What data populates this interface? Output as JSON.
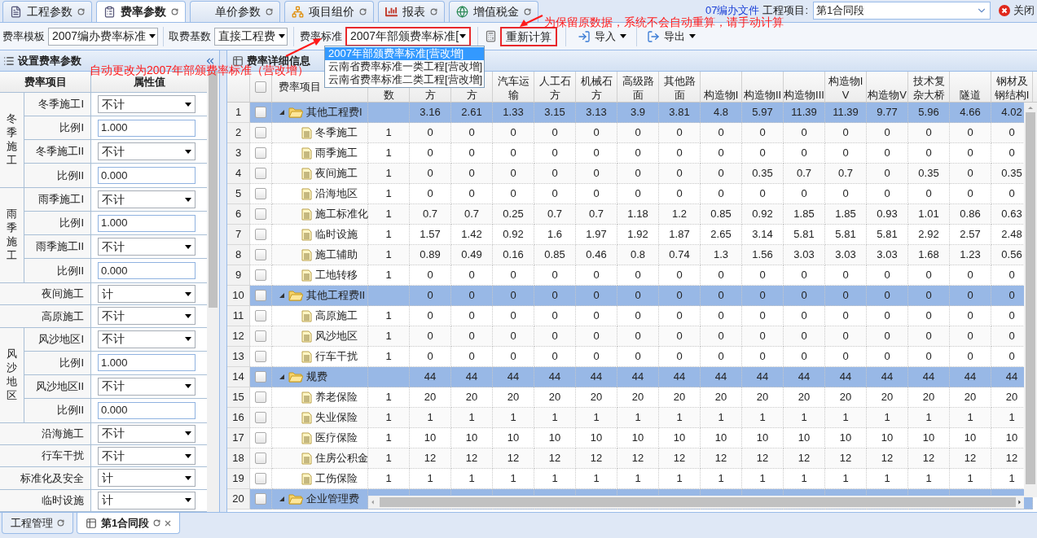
{
  "top_tabs": [
    {
      "label": "工程参数",
      "selected": false
    },
    {
      "label": "费率参数",
      "selected": true
    },
    {
      "label": "单价参数",
      "selected": false
    },
    {
      "label": "项目组价",
      "selected": false
    },
    {
      "label": "报表",
      "selected": false
    },
    {
      "label": "增值税金",
      "selected": false
    }
  ],
  "header_right": {
    "link": "07编办文件",
    "project_label": "工程项目:",
    "project_value": "第1合同段",
    "close": "关闭"
  },
  "toolbar": {
    "template_label": "费率模板",
    "template_value": "2007编办费率标准",
    "base_label": "取费基数",
    "base_value": "直接工程费",
    "standard_label": "费率标准",
    "standard_value": "2007年部颁费率标准[",
    "recalc": "重新计算",
    "import": "导入",
    "export": "导出"
  },
  "standard_options": [
    {
      "label": "2007年部颁费率标准[营改增]",
      "selected": true
    },
    {
      "label": "云南省费率标准一类工程[营改增]",
      "selected": false
    },
    {
      "label": "云南省费率标准二类工程[营改增]",
      "selected": false
    }
  ],
  "annotations": [
    "为保留原数据，系统不会自动重算，请手动计算",
    "自动更改为2007年部颁费率标准（营改增）"
  ],
  "left_panel": {
    "title": "设置费率参数",
    "columns": [
      "费率项目",
      "属性值"
    ],
    "params": [
      {
        "group": "冬季施工",
        "items": [
          {
            "label": "冬季施工I",
            "kind": "select",
            "value": "不计"
          },
          {
            "label": "比例I",
            "kind": "input",
            "value": "1.000"
          },
          {
            "label": "冬季施工II",
            "kind": "select",
            "value": "不计"
          },
          {
            "label": "比例II",
            "kind": "input",
            "value": "0.000"
          }
        ]
      },
      {
        "group": "雨季施工",
        "items": [
          {
            "label": "雨季施工I",
            "kind": "select",
            "value": "不计"
          },
          {
            "label": "比例I",
            "kind": "input",
            "value": "1.000"
          },
          {
            "label": "雨季施工II",
            "kind": "select",
            "value": "不计"
          },
          {
            "label": "比例II",
            "kind": "input",
            "value": "0.000"
          }
        ]
      },
      {
        "label": "夜间施工",
        "kind": "select",
        "value": "计"
      },
      {
        "label": "高原施工",
        "kind": "select",
        "value": "不计"
      },
      {
        "group": "风沙地区",
        "items": [
          {
            "label": "风沙地区I",
            "kind": "select",
            "value": "不计"
          },
          {
            "label": "比例I",
            "kind": "input",
            "value": "1.000"
          },
          {
            "label": "风沙地区II",
            "kind": "select",
            "value": "不计"
          },
          {
            "label": "比例II",
            "kind": "input",
            "value": "0.000"
          }
        ]
      },
      {
        "label": "沿海施工",
        "kind": "select",
        "value": "不计"
      },
      {
        "label": "行车干扰",
        "kind": "select",
        "value": "不计"
      },
      {
        "label": "标准化及安全",
        "kind": "select",
        "value": "计"
      },
      {
        "label": "临时设施",
        "kind": "select",
        "value": "计"
      }
    ]
  },
  "right_panel": {
    "title": "费率详细信息",
    "header_checked": false,
    "columns": [
      "费率项目",
      "数",
      "方",
      "方",
      "汽车运输",
      "人工石方",
      "机械石方",
      "高级路面",
      "其他路面",
      "构造物I",
      "构造物II",
      "构造物III",
      "构造物IV",
      "构造物V",
      "技术复杂大桥",
      "隧道",
      "钢材及钢结构I"
    ],
    "rows": [
      {
        "number": "1",
        "name": "其他工程费I",
        "expanded": true,
        "checked": false,
        "values": [
          "3.16",
          "2.61",
          "1.33",
          "3.15",
          "3.13",
          "3.9",
          "3.81",
          "4.8",
          "5.97",
          "11.39",
          "11.39",
          "9.77",
          "5.96",
          "4.66",
          "4.02"
        ],
        "children": [
          {
            "number": "2",
            "name": "冬季施工",
            "checked": false,
            "factor": "1",
            "values": [
              "0",
              "0",
              "0",
              "0",
              "0",
              "0",
              "0",
              "0",
              "0",
              "0",
              "0",
              "0",
              "0",
              "0",
              "0"
            ]
          },
          {
            "number": "3",
            "name": "雨季施工",
            "checked": false,
            "factor": "1",
            "values": [
              "0",
              "0",
              "0",
              "0",
              "0",
              "0",
              "0",
              "0",
              "0",
              "0",
              "0",
              "0",
              "0",
              "0",
              "0"
            ]
          },
          {
            "number": "4",
            "name": "夜间施工",
            "checked": false,
            "factor": "1",
            "values": [
              "0",
              "0",
              "0",
              "0",
              "0",
              "0",
              "0",
              "0",
              "0.35",
              "0.7",
              "0.7",
              "0",
              "0.35",
              "0",
              "0.35"
            ]
          },
          {
            "number": "5",
            "name": "沿海地区",
            "checked": false,
            "factor": "1",
            "values": [
              "0",
              "0",
              "0",
              "0",
              "0",
              "0",
              "0",
              "0",
              "0",
              "0",
              "0",
              "0",
              "0",
              "0",
              "0"
            ]
          },
          {
            "number": "6",
            "name": "施工标准化",
            "checked": false,
            "factor": "1",
            "values": [
              "0.7",
              "0.7",
              "0.25",
              "0.7",
              "0.7",
              "1.18",
              "1.2",
              "0.85",
              "0.92",
              "1.85",
              "1.85",
              "0.93",
              "1.01",
              "0.86",
              "0.63"
            ]
          },
          {
            "number": "7",
            "name": "临时设施",
            "checked": false,
            "factor": "1",
            "values": [
              "1.57",
              "1.42",
              "0.92",
              "1.6",
              "1.97",
              "1.92",
              "1.87",
              "2.65",
              "3.14",
              "5.81",
              "5.81",
              "5.81",
              "2.92",
              "2.57",
              "2.48"
            ]
          },
          {
            "number": "8",
            "name": "施工辅助",
            "checked": false,
            "factor": "1",
            "values": [
              "0.89",
              "0.49",
              "0.16",
              "0.85",
              "0.46",
              "0.8",
              "0.74",
              "1.3",
              "1.56",
              "3.03",
              "3.03",
              "3.03",
              "1.68",
              "1.23",
              "0.56"
            ]
          },
          {
            "number": "9",
            "name": "工地转移",
            "checked": false,
            "factor": "1",
            "values": [
              "0",
              "0",
              "0",
              "0",
              "0",
              "0",
              "0",
              "0",
              "0",
              "0",
              "0",
              "0",
              "0",
              "0",
              "0"
            ]
          }
        ]
      },
      {
        "number": "10",
        "name": "其他工程费II",
        "expanded": true,
        "checked": false,
        "values": [
          "0",
          "0",
          "0",
          "0",
          "0",
          "0",
          "0",
          "0",
          "0",
          "0",
          "0",
          "0",
          "0",
          "0",
          "0"
        ],
        "children": [
          {
            "number": "11",
            "name": "高原施工",
            "checked": false,
            "factor": "1",
            "values": [
              "0",
              "0",
              "0",
              "0",
              "0",
              "0",
              "0",
              "0",
              "0",
              "0",
              "0",
              "0",
              "0",
              "0",
              "0"
            ]
          },
          {
            "number": "12",
            "name": "风沙地区",
            "checked": false,
            "factor": "1",
            "values": [
              "0",
              "0",
              "0",
              "0",
              "0",
              "0",
              "0",
              "0",
              "0",
              "0",
              "0",
              "0",
              "0",
              "0",
              "0"
            ]
          },
          {
            "number": "13",
            "name": "行车干扰",
            "checked": false,
            "factor": "1",
            "values": [
              "0",
              "0",
              "0",
              "0",
              "0",
              "0",
              "0",
              "0",
              "0",
              "0",
              "0",
              "0",
              "0",
              "0",
              "0"
            ]
          }
        ]
      },
      {
        "number": "14",
        "name": "规费",
        "expanded": true,
        "checked": false,
        "values": [
          "44",
          "44",
          "44",
          "44",
          "44",
          "44",
          "44",
          "44",
          "44",
          "44",
          "44",
          "44",
          "44",
          "44",
          "44"
        ],
        "children": [
          {
            "number": "15",
            "name": "养老保险",
            "checked": false,
            "factor": "1",
            "values": [
              "20",
              "20",
              "20",
              "20",
              "20",
              "20",
              "20",
              "20",
              "20",
              "20",
              "20",
              "20",
              "20",
              "20",
              "20"
            ]
          },
          {
            "number": "16",
            "name": "失业保险",
            "checked": false,
            "factor": "1",
            "values": [
              "1",
              "1",
              "1",
              "1",
              "1",
              "1",
              "1",
              "1",
              "1",
              "1",
              "1",
              "1",
              "1",
              "1",
              "1"
            ]
          },
          {
            "number": "17",
            "name": "医疗保险",
            "checked": false,
            "factor": "1",
            "values": [
              "10",
              "10",
              "10",
              "10",
              "10",
              "10",
              "10",
              "10",
              "10",
              "10",
              "10",
              "10",
              "10",
              "10",
              "10"
            ]
          },
          {
            "number": "18",
            "name": "住房公积金",
            "checked": false,
            "factor": "1",
            "values": [
              "12",
              "12",
              "12",
              "12",
              "12",
              "12",
              "12",
              "12",
              "12",
              "12",
              "12",
              "12",
              "12",
              "12",
              "12"
            ]
          },
          {
            "number": "19",
            "name": "工伤保险",
            "checked": false,
            "factor": "1",
            "values": [
              "1",
              "1",
              "1",
              "1",
              "1",
              "1",
              "1",
              "1",
              "1",
              "1",
              "1",
              "1",
              "1",
              "1",
              "1"
            ]
          }
        ]
      },
      {
        "number": "20",
        "name": "企业管理费",
        "expanded": true,
        "checked": false
      }
    ]
  },
  "bottom_tabs": [
    {
      "label": "工程管理",
      "selected": false,
      "closable": false
    },
    {
      "label": "第1合同段",
      "selected": true,
      "closable": true
    }
  ]
}
